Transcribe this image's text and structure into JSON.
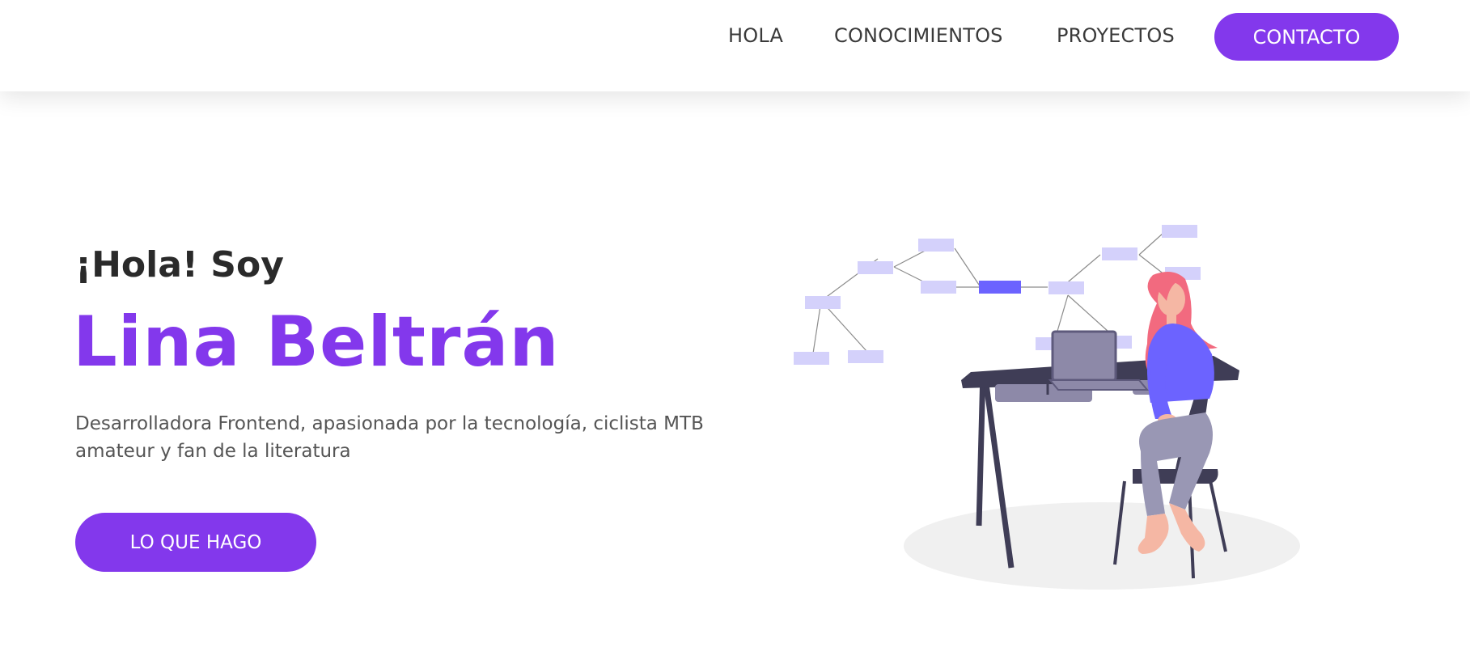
{
  "colors": {
    "accent": "#8338ec",
    "dark_text": "#2a2a2a",
    "body_text": "#555555",
    "illustration_box": "#d4d1fb",
    "illustration_box_active": "#6c63ff",
    "desk": "#3f3d56",
    "drawer": "#8d89a8",
    "hair": "#f26a7f",
    "skin": "#f5b7a4",
    "shirt": "#6c63ff",
    "pants": "#9997b4",
    "floor": "#f0f0f0"
  },
  "nav": {
    "items": [
      {
        "label": "HOLA"
      },
      {
        "label": "CONOCIMIENTOS"
      },
      {
        "label": "PROYECTOS"
      }
    ],
    "contact_label": "CONTACTO"
  },
  "hero": {
    "greeting": "¡Hola! Soy",
    "name": "Lina Beltrán",
    "description": "Desarrolladora Frontend, apasionada por la tecnología, ciclista MTB amateur y fan de la literatura",
    "cta_label": "LO QUE HAGO"
  },
  "illustration": {
    "icon": "woman-at-desk-illustration"
  }
}
